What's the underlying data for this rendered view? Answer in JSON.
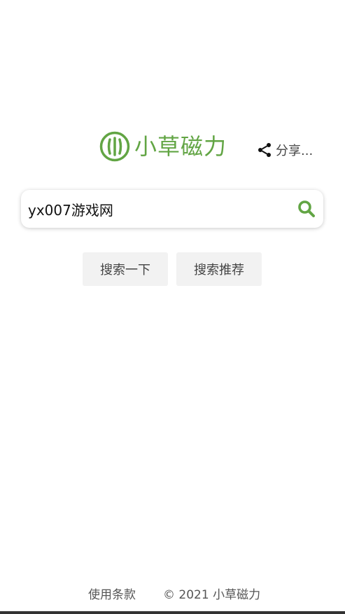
{
  "header": {
    "logo_icon": "grass-logo-icon",
    "logo_text": "小草磁力",
    "share_icon": "share-icon",
    "share_label": "分享..."
  },
  "search": {
    "value": "yx007游戏网",
    "icon": "search-icon"
  },
  "buttons": {
    "search_label": "搜索一下",
    "recommend_label": "搜索推荐"
  },
  "footer": {
    "terms_label": "使用条款",
    "copyright": "© 2021 小草磁力"
  },
  "colors": {
    "brand_green": "#62a544",
    "button_bg": "#f2f2f2",
    "text_gray": "#444444"
  }
}
